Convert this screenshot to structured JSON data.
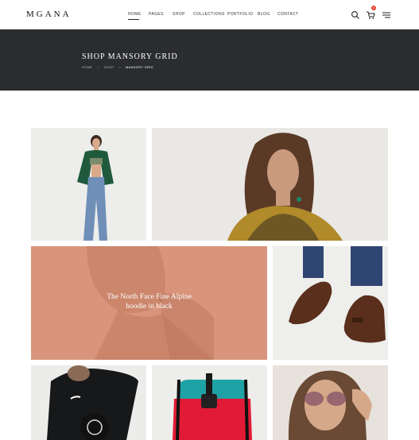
{
  "header": {
    "logo": "MGANA",
    "nav": [
      "HOME",
      "PAGES",
      "SHOP",
      "COLLECTIONS",
      "PORTFOLIO",
      "BLOG",
      "CONTACT"
    ],
    "cart_count": "0",
    "icons": [
      "search-icon",
      "cart-icon",
      "menu-icon"
    ]
  },
  "banner": {
    "title": "SHOP MANSORY GRID",
    "breadcrumb": [
      "HOME",
      "SHOP",
      "MANSORY GRID"
    ]
  },
  "grid": {
    "featured_caption_line1": "The North Face Fine Alpine",
    "featured_caption_line2": "hoodie in black"
  },
  "colors": {
    "banner_bg": "#2b2c2e",
    "overlay": "#d9957c",
    "badge": "#e8402b"
  }
}
